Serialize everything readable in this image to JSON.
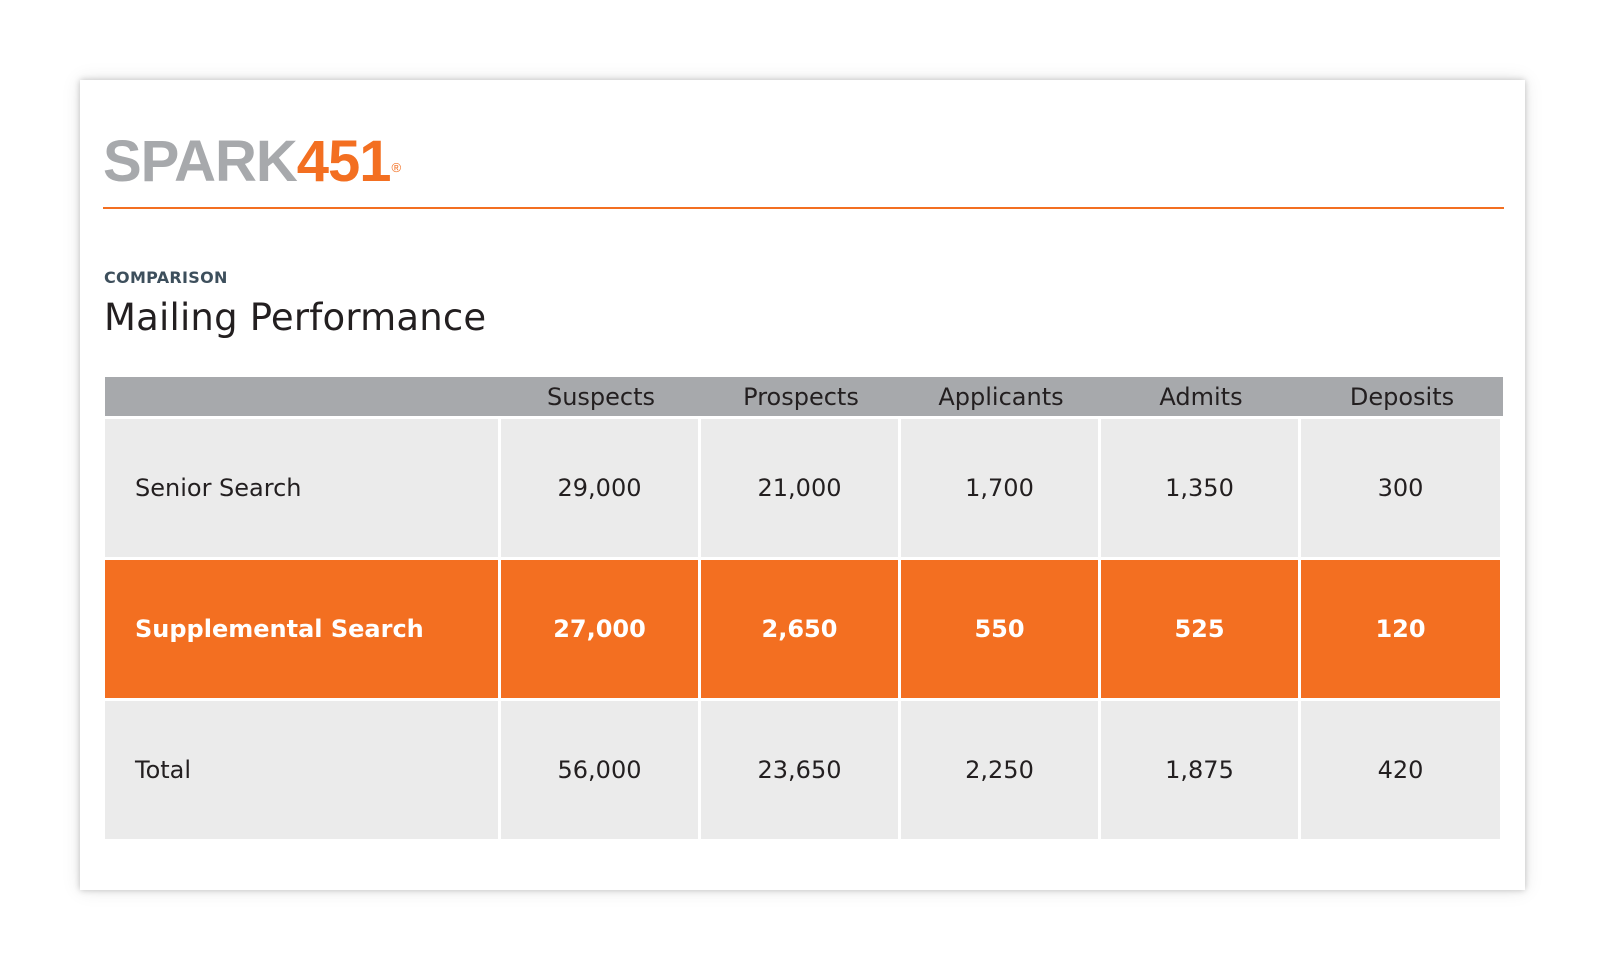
{
  "brand": {
    "logo_part_a": "SPARK",
    "logo_part_b": "451",
    "registered_mark": "®",
    "colors": {
      "gray": "#a7a9ac",
      "orange": "#f36f21"
    }
  },
  "header": {
    "eyebrow": "COMPARISON",
    "title": "Mailing Performance"
  },
  "chart_data": {
    "type": "table",
    "columns": [
      "",
      "Suspects",
      "Prospects",
      "Applicants",
      "Admits",
      "Deposits"
    ],
    "rows": [
      {
        "label": "Senior Search",
        "highlight": false,
        "display": [
          "29,000",
          "21,000",
          "1,700",
          "1,350",
          "300"
        ],
        "values": [
          29000,
          21000,
          1700,
          1350,
          300
        ]
      },
      {
        "label": "Supplemental Search",
        "highlight": true,
        "display": [
          "27,000",
          "2,650",
          "550",
          "525",
          "120"
        ],
        "values": [
          27000,
          2650,
          550,
          525,
          120
        ]
      },
      {
        "label": "Total",
        "highlight": false,
        "display": [
          "56,000",
          "23,650",
          "2,250",
          "1,875",
          "420"
        ],
        "values": [
          56000,
          23650,
          2250,
          1875,
          420
        ]
      }
    ],
    "colors": {
      "header_bg": "#a7a9ac",
      "row_bg": "#ebebeb",
      "highlight_bg": "#f36f21",
      "highlight_text": "#ffffff"
    }
  }
}
